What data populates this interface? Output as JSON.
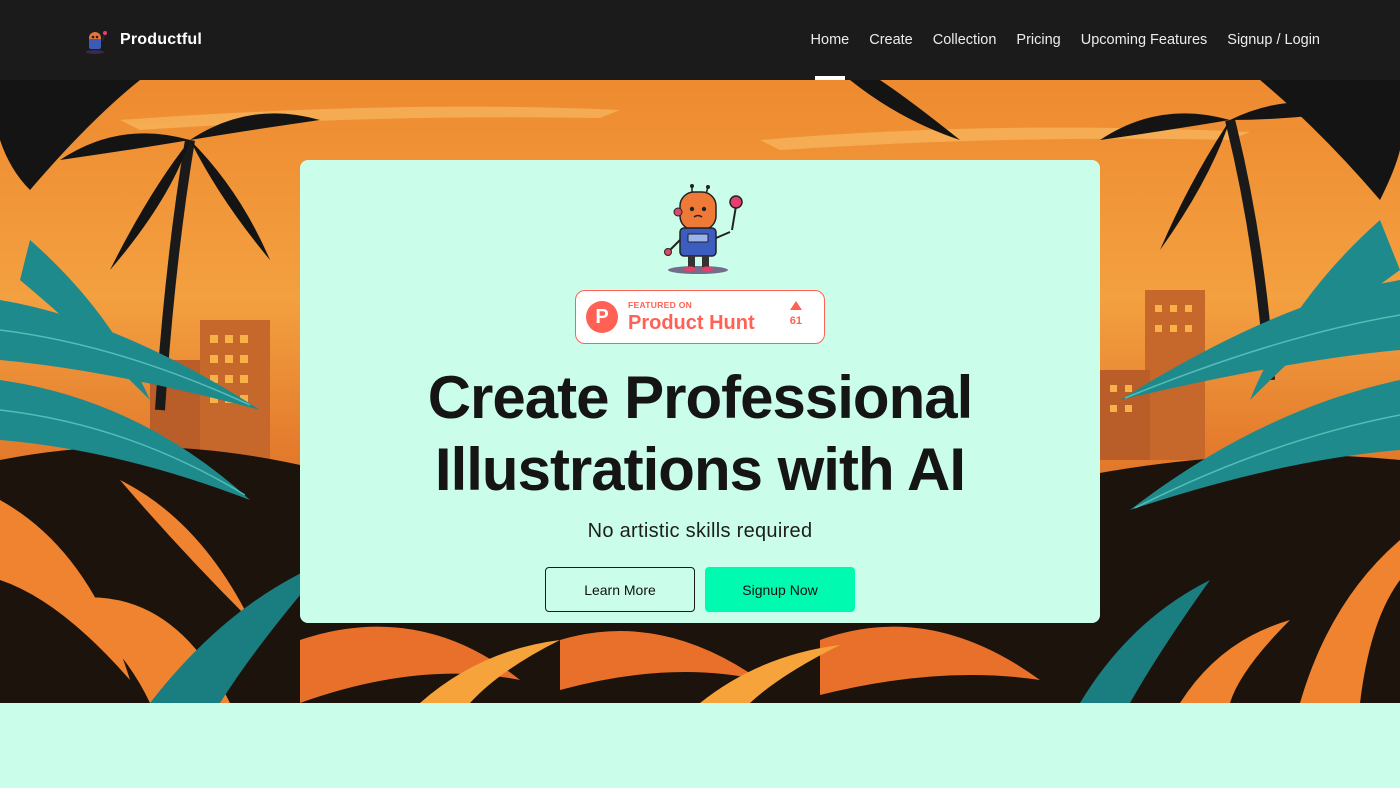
{
  "nav": {
    "brand": "Productful",
    "brand_icon": "robot-logo-icon",
    "items": [
      {
        "label": "Home",
        "active": true
      },
      {
        "label": "Create",
        "active": false
      },
      {
        "label": "Collection",
        "active": false
      },
      {
        "label": "Pricing",
        "active": false
      },
      {
        "label": "Upcoming Features",
        "active": false
      },
      {
        "label": "Signup / Login",
        "active": false
      }
    ]
  },
  "hero": {
    "background": "tropical-jungle-sunset-illustration",
    "mascot_icon": "robot-mascot-icon",
    "badge": {
      "small": "FEATURED ON",
      "big": "Product Hunt",
      "logo_letter": "P",
      "votes": "61",
      "color": "#ff6154"
    },
    "headline": "Create Professional Illustrations with AI",
    "subhead": "No artistic skills required",
    "learn_more": "Learn More",
    "signup": "Signup Now"
  },
  "colors": {
    "nav_bg": "#1b1b1b",
    "card_bg": "#cbfdeb",
    "accent": "#00fab0",
    "sky": "#f08a2c",
    "foliage_teal": "#1e8a8c"
  }
}
